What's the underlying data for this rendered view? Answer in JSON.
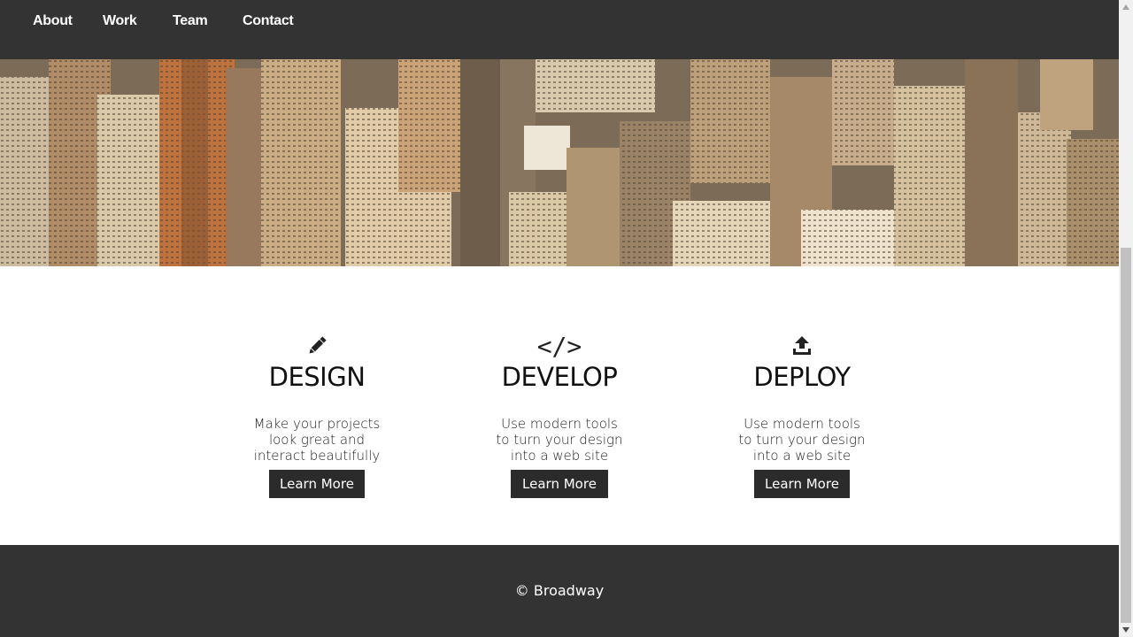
{
  "nav": {
    "links": [
      "About",
      "Work",
      "Team",
      "Contact"
    ]
  },
  "hero": {
    "image": "aerial-city-skyline"
  },
  "features": [
    {
      "icon": "pencil-icon",
      "title": "DESIGN",
      "description": "Make your projects look great and interact beautifully",
      "button": "Learn More"
    },
    {
      "icon": "code-icon",
      "glyph": "</>",
      "title": "DEVELOP",
      "description": "Use modern tools to turn your design into a web site",
      "button": "Learn More"
    },
    {
      "icon": "upload-icon",
      "title": "DEPLOY",
      "description": "Use modern tools to turn your design into a web site",
      "button": "Learn More"
    }
  ],
  "footer": {
    "copyright": "© Broadway"
  },
  "colors": {
    "nav_bg": "#333333",
    "button_bg": "#2b2b2b",
    "text": "#222222"
  }
}
